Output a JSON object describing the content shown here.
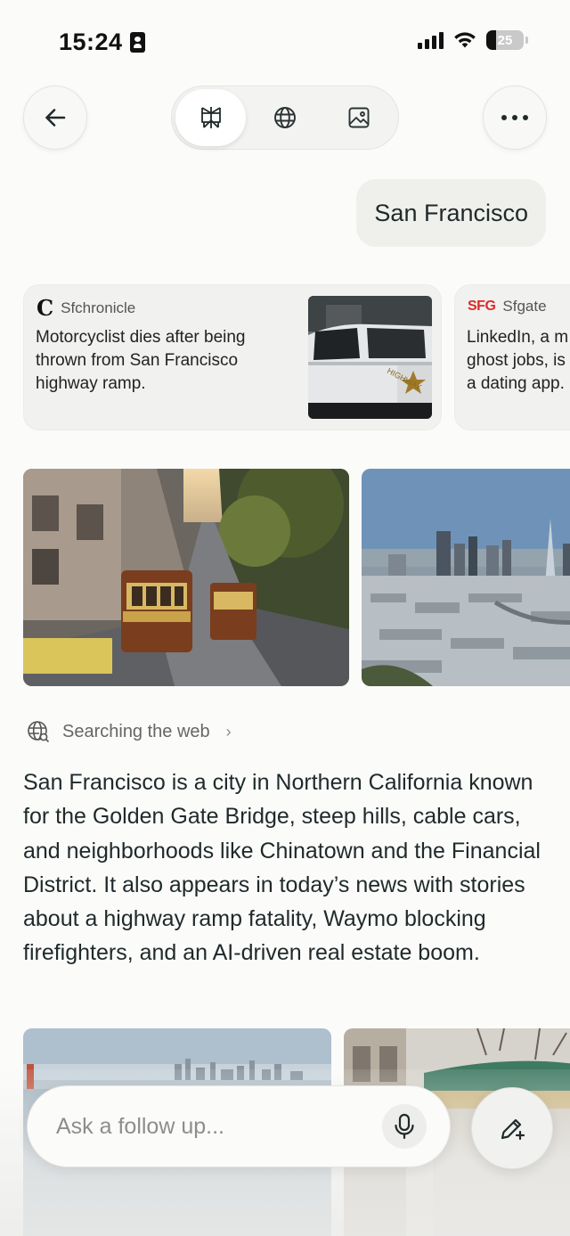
{
  "status_bar": {
    "time": "15:24",
    "battery_level": "25",
    "battery_fraction": 0.25
  },
  "top_bar": {
    "back_icon": "arrow-left-icon",
    "modes": [
      {
        "name": "perplexity-logo-icon",
        "active": true
      },
      {
        "name": "globe-icon",
        "active": false
      },
      {
        "name": "image-icon",
        "active": false
      }
    ],
    "more_icon": "more-horizontal-icon"
  },
  "query": {
    "text": "San Francisco"
  },
  "news": [
    {
      "source": "Sfchronicle",
      "logo_text": "C",
      "headline": "Motorcyclist dies after being thrown from San Francisco highway ramp."
    },
    {
      "source": "Sfgate",
      "logo_text": "SFG",
      "headline_lines": [
        "LinkedIn, a m",
        "ghost jobs, is",
        "a dating app."
      ]
    }
  ],
  "searching": {
    "label": "Searching the web",
    "chevron": "›"
  },
  "answer": {
    "text": "San Francisco is a city in Northern California known for the Golden Gate Bridge, steep hills, cable cars, and neighborhoods like Chinatown and the Financial District. It also appears in today’s news with stories about a highway ramp fatality, Waymo blocking firefighters, and an AI-driven real estate boom."
  },
  "composer": {
    "placeholder": "Ask a follow up...",
    "mic_icon": "microphone-icon",
    "new_thread_icon": "pencil-plus-icon"
  },
  "colors": {
    "background": "#fbfbfa",
    "text": "#1f2a2a",
    "bubble": "#efefec",
    "sfgate_red": "#d92b2b"
  }
}
